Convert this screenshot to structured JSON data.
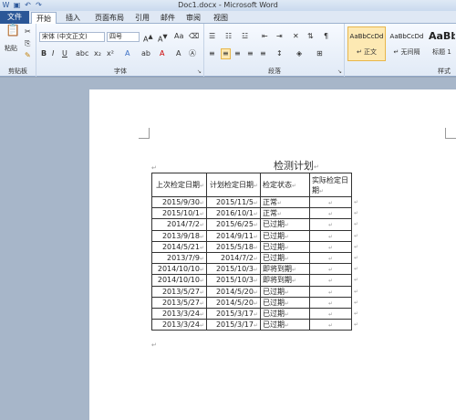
{
  "window": {
    "title": "Doc1.docx - Microsoft Word"
  },
  "tabs": [
    {
      "label": "文件"
    },
    {
      "label": "开始"
    },
    {
      "label": "插入"
    },
    {
      "label": "页面布局"
    },
    {
      "label": "引用"
    },
    {
      "label": "邮件"
    },
    {
      "label": "审阅"
    },
    {
      "label": "视图"
    }
  ],
  "ribbon": {
    "clipboard_label": "剪贴板",
    "paste_label": "粘贴",
    "font_label": "字体",
    "paragraph_label": "段落",
    "styles_label": "样式",
    "font_name": "宋体 (中文正文)",
    "font_size": "四号",
    "styles": [
      {
        "sample": "AaBbCcDd",
        "name": "↵ 正文"
      },
      {
        "sample": "AaBbCcDd",
        "name": "↵ 无间隔"
      },
      {
        "sample": "AaBb",
        "name": "标题 1"
      }
    ]
  },
  "document": {
    "title": "检测计划",
    "table": {
      "headers": [
        "上次检定日期",
        "计划检定日期",
        "检定状态",
        "实际检定日期"
      ],
      "rows": [
        [
          "2015/9/30",
          "2015/11/5",
          "正常",
          ""
        ],
        [
          "2015/10/1",
          "2016/10/1",
          "正常",
          ""
        ],
        [
          "2014/7/2",
          "2015/6/25",
          "已过期",
          ""
        ],
        [
          "2013/9/18",
          "2014/9/11",
          "已过期",
          ""
        ],
        [
          "2014/5/21",
          "2015/5/18",
          "已过期",
          ""
        ],
        [
          "2013/7/9",
          "2014/7/2",
          "已过期",
          ""
        ],
        [
          "2014/10/10",
          "2015/10/3",
          "即将到期",
          ""
        ],
        [
          "2014/10/10",
          "2015/10/3",
          "即将到期",
          ""
        ],
        [
          "2013/5/27",
          "2014/5/20",
          "已过期",
          ""
        ],
        [
          "2013/5/27",
          "2014/5/20",
          "已过期",
          ""
        ],
        [
          "2013/3/24",
          "2015/3/17",
          "已过期",
          ""
        ],
        [
          "2013/3/24",
          "2015/3/17",
          "已过期",
          ""
        ]
      ]
    }
  }
}
